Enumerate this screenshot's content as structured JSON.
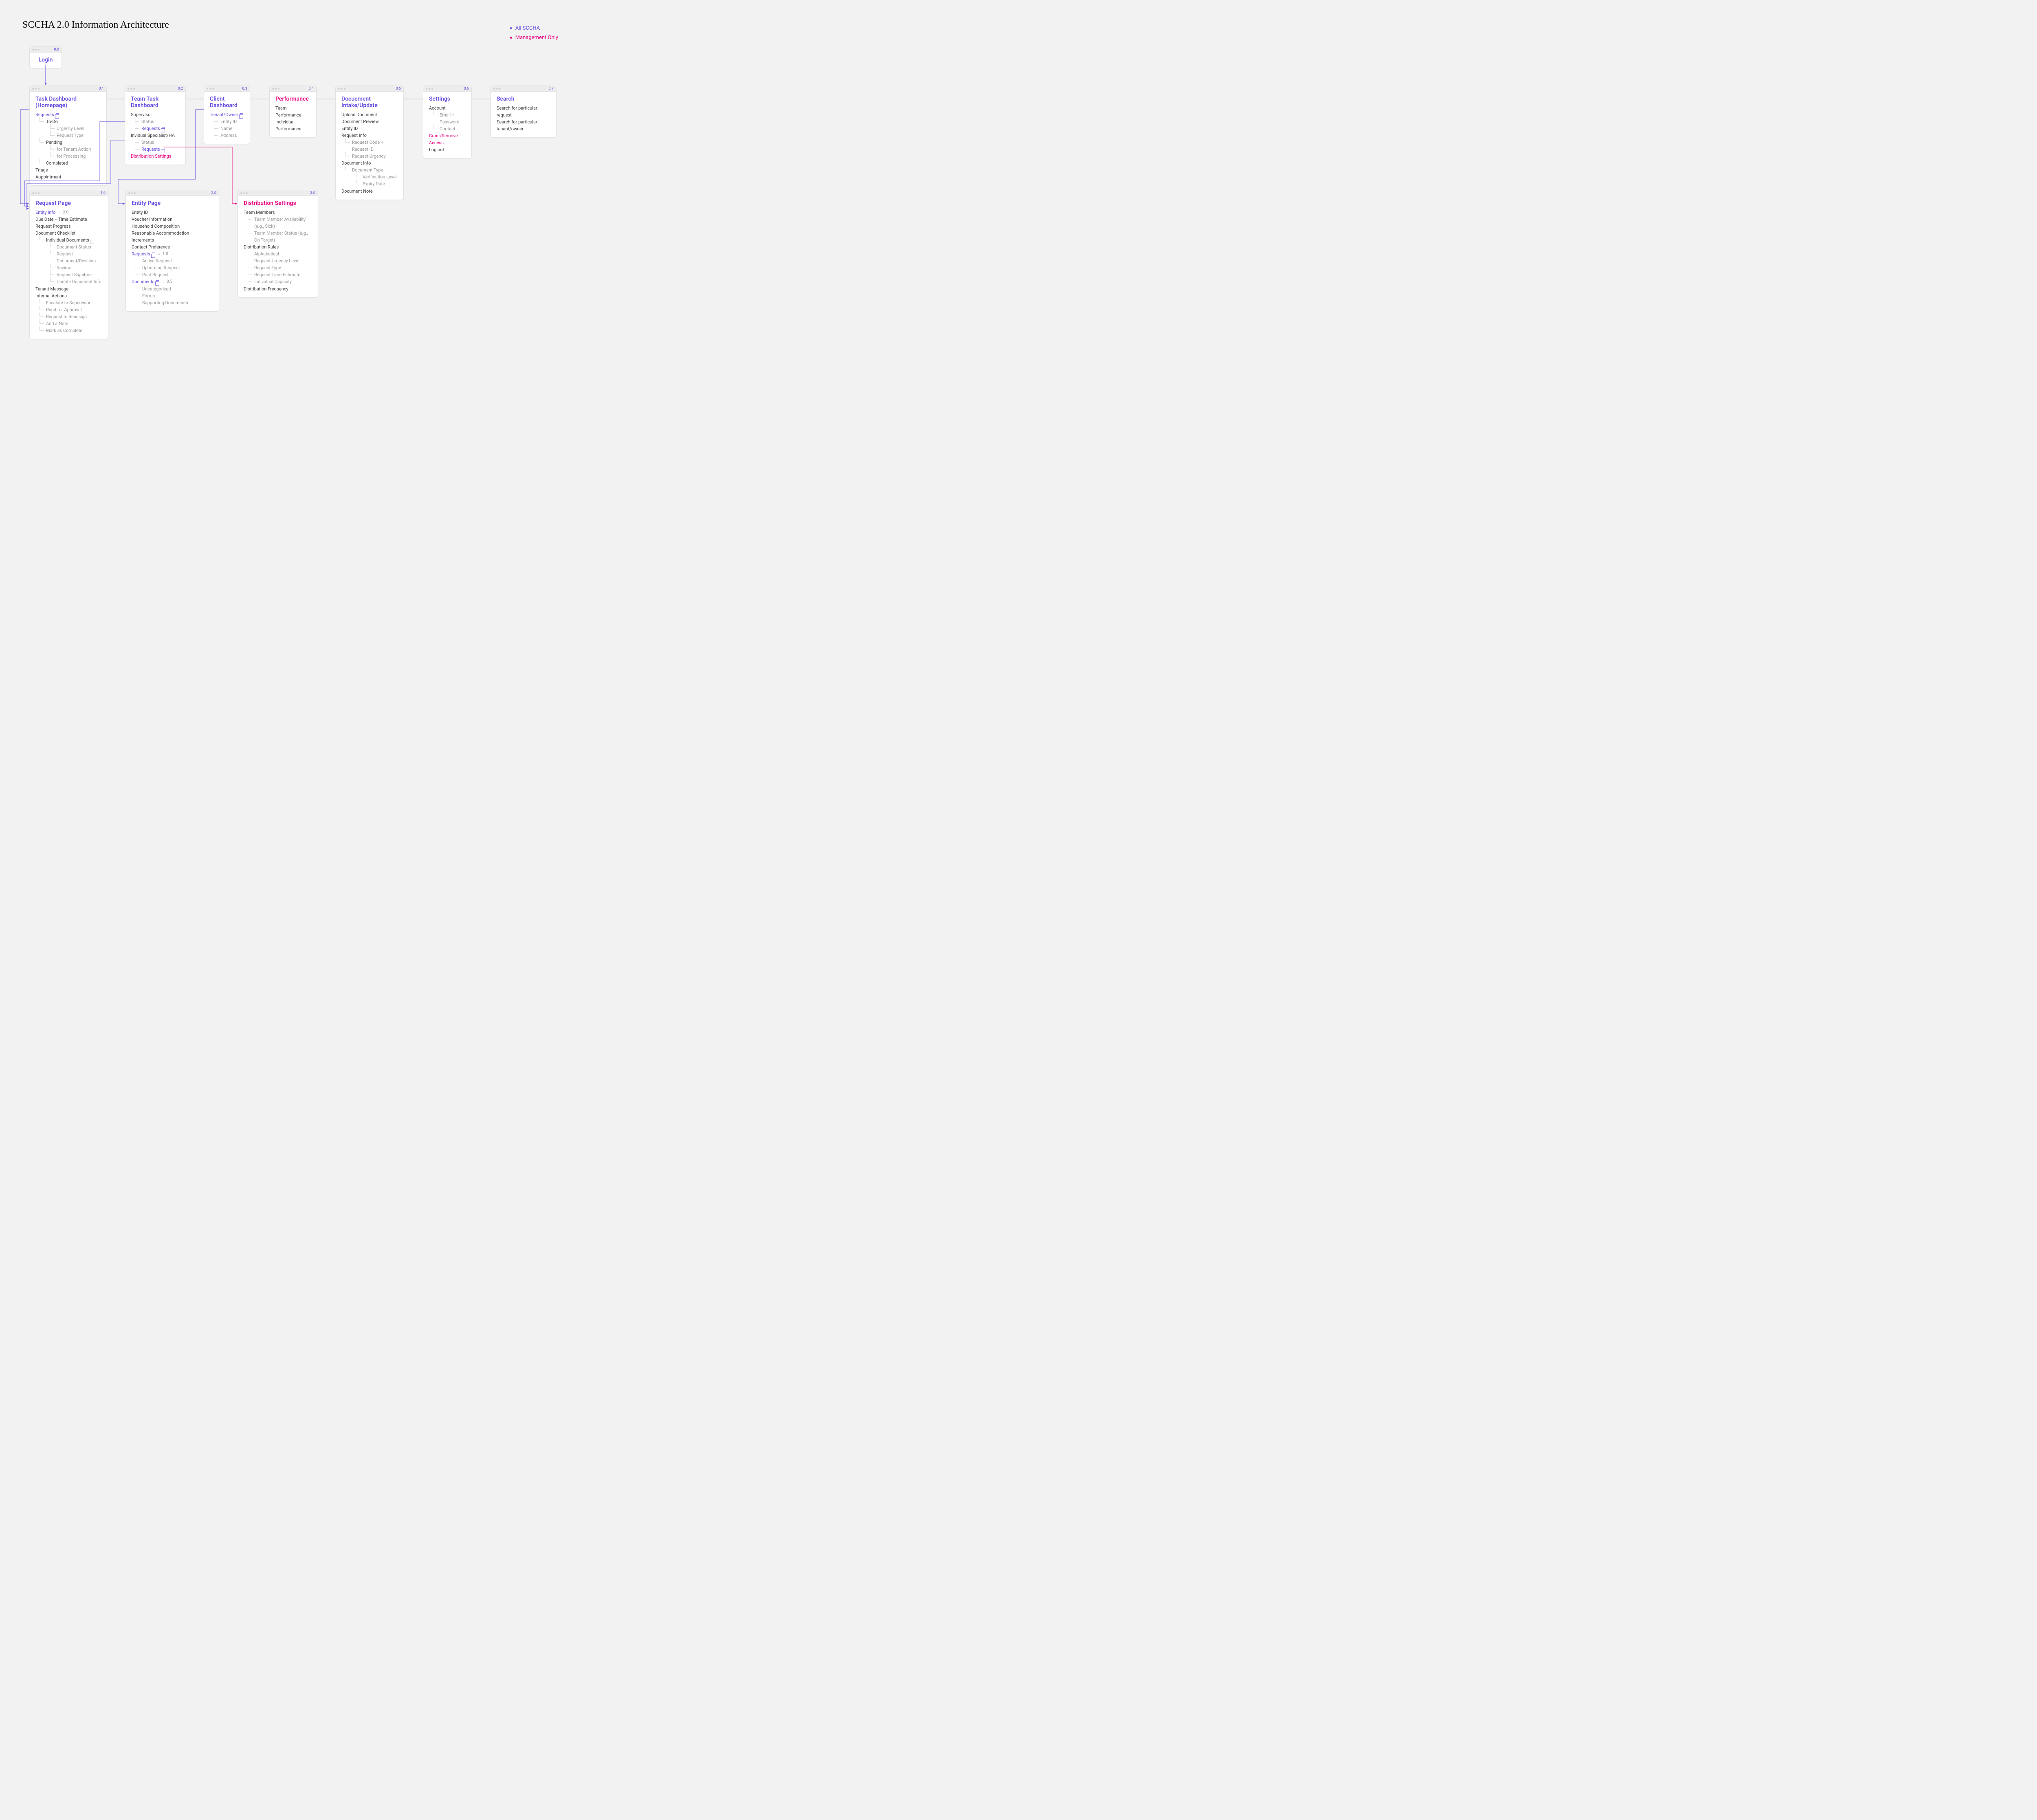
{
  "page_title": "SCCHA 2.0 Information Architecture",
  "legend": {
    "all": "All SCCHA",
    "mgmt": "Management Only"
  },
  "cards": {
    "login": {
      "id": "0.0",
      "title": "Login"
    },
    "task_dashboard": {
      "id": "0.1",
      "title": "Task Dashboard (Homepage)",
      "requests": "Requests",
      "todo": "To-Do",
      "urgency": "Urgency Level",
      "request_type": "Request Type",
      "pending": "Pending",
      "for_tenant": "for Tenant Action",
      "for_processing": "for Processing",
      "completed": "Completed",
      "triage": "Triage",
      "appointment": "Appointment"
    },
    "team_dashboard": {
      "id": "0.2",
      "title": "Team Task Dashboard",
      "supervisor": "Supervisor",
      "status": "Status",
      "requests": "Requests",
      "specialist": "Invidual Specialist/HA",
      "status2": "Status",
      "requests2": "Requests",
      "dist": "Distribution Settings"
    },
    "client_dashboard": {
      "id": "0.3",
      "title": "Client Dashboard",
      "tenant_owner": "Tenant/Owner",
      "entity_id": "Entity ID",
      "name": "Name",
      "address": "Address"
    },
    "performance": {
      "id": "0.4",
      "title": "Performance",
      "team_perf": "Team Performance",
      "ind_perf": "Individual Performance"
    },
    "doc_intake": {
      "id": "0.5",
      "title": "Docuement Intake/Update",
      "upload": "Upload Document",
      "preview": "Document Preview",
      "entity_id": "Entity ID",
      "req_info": "Request Info",
      "req_code": "Request Code + Request ID",
      "req_urg": "Request Urgency",
      "doc_info": "Document Info",
      "doc_type": "Document Type",
      "verif": "Verification Level",
      "expiry": "Expiry Date",
      "doc_note": "Document Note"
    },
    "settings": {
      "id": "0.6",
      "title": "Settings",
      "account": "Account",
      "email_pw": "Email + Password",
      "contact": "Contact",
      "grant": "Grant/Remove Access",
      "logout": "Log out"
    },
    "search": {
      "id": "0.7",
      "title": "Search",
      "req": "Search for particular request",
      "tenant": "Search for particular tenant/owner"
    },
    "request_page": {
      "id": "1.0",
      "title": "Request Page",
      "entity_info": "Entity Info",
      "entity_ref": "2.0",
      "due_date": "Due Date + Time Estimate",
      "progress": "Request Progress",
      "checklist": "Document Checklist",
      "ind_docs": "Individual Documents",
      "doc_status": "Document Status",
      "req_doc": "Request Document/Revision",
      "review": "Review",
      "req_sig": "Request Signiture",
      "update_doc": "Update Document Info",
      "tenant_msg": "Tenant Message",
      "internal": "Internal Actions",
      "escalate": "Escalate to Supervisor",
      "pend": "Pend for Approval",
      "reassign": "Request to Reassign",
      "add_note": "Add a Note",
      "mark_complete": "Mark as Complete"
    },
    "entity_page": {
      "id": "2.0",
      "title": "Entity Page",
      "entity_id": "Entity ID",
      "voucher": "Voucher Information",
      "household": "Household Composition",
      "accom": "Reasonable Accommodation",
      "increments": "Increments",
      "contact_pref": "Contact Preference",
      "requests": "Requests",
      "req_ref": "1.0",
      "active": "Active Request",
      "upcoming": "Upcoming Request",
      "past": "Past Request",
      "documents": "Documents",
      "doc_ref": "0.5",
      "uncat": "Uncategorized",
      "forms": "Forms",
      "supporting": "Supporting Documents"
    },
    "dist_settings": {
      "id": "3.0",
      "title": "Distribution Settings",
      "team_members": "Team Members",
      "availability": "Team Member Availability (e.g., Sick)",
      "status": "Team Member Status (e.g., On Target)",
      "rules": "Distribution Rules",
      "alpha": "Alphabetical",
      "urgency": "Request Urgency Level",
      "req_type": "Request Type",
      "time_est": "Request Time Estimate",
      "capacity": "Individual Capacity",
      "frequency": "Distribution Frequency"
    }
  }
}
